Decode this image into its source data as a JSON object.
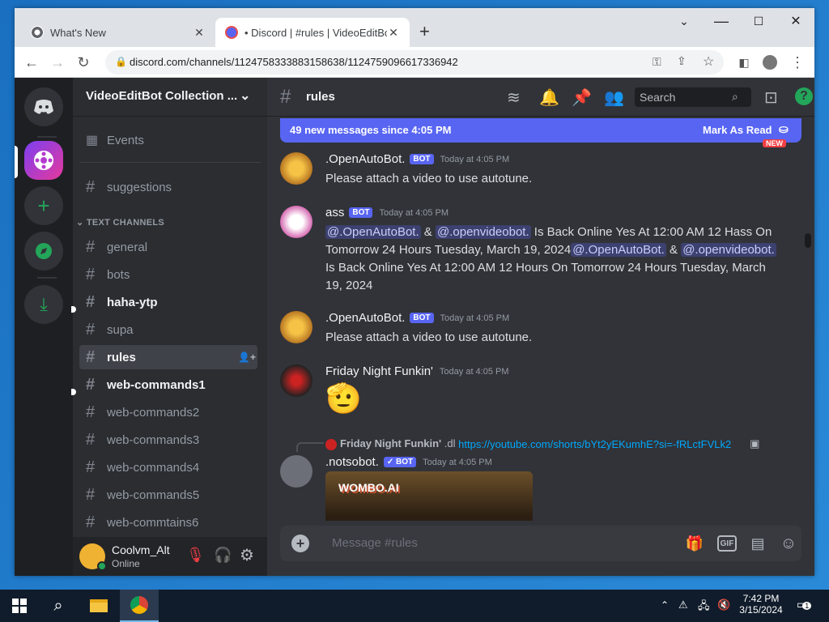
{
  "browser": {
    "tabs": [
      {
        "title": "What's New"
      },
      {
        "title": "• Discord | #rules | VideoEditBot"
      }
    ],
    "new_tab": "+",
    "url": "discord.com/channels/1124758333883158638/1124759096617336942"
  },
  "discord": {
    "server_name": "VideoEditBot Collection ...",
    "events_label": "Events",
    "suggestions_label": "suggestions",
    "category_label": "TEXT CHANNELS",
    "channels": [
      {
        "name": "general"
      },
      {
        "name": "bots"
      },
      {
        "name": "haha-ytp"
      },
      {
        "name": "supa"
      },
      {
        "name": "rules"
      },
      {
        "name": "web-commands1"
      },
      {
        "name": "web-commands2"
      },
      {
        "name": "web-commands3"
      },
      {
        "name": "web-commands4"
      },
      {
        "name": "web-commands5"
      },
      {
        "name": "web-commtains6"
      }
    ],
    "user": {
      "name": "Coolvm_Alt",
      "status": "Online"
    },
    "chat_header": {
      "channel": "rules",
      "search_placeholder": "Search"
    },
    "new_messages": {
      "text": "49 new messages since 4:05 PM",
      "action": "Mark As Read",
      "new_tag": "NEW"
    },
    "messages": [
      {
        "author": "OpenAutoBot.",
        "prefix": ".",
        "bot": "BOT",
        "time": "Today at 4:05 PM",
        "text": "Please attach a video to use autotune."
      },
      {
        "author": "ass",
        "bot": "BOT",
        "time": "Today at 4:05 PM",
        "mention1": "@.OpenAutoBot.",
        "amp1": " & ",
        "mention2": "@.openvideobot.",
        "text1": " Is Back Online Yes At 12:00 AM 12 Hass On Tomorrow 24 Hours Tuesday, March 19, 2024",
        "mention3": "@.OpenAutoBot.",
        "amp2": " & ",
        "mention4": "@.openvideobot.",
        "text2": " Is Back Online Yes At 12:00 AM 12 Hours On Tomorrow 24 Hours Tuesday, March 19, 2024"
      },
      {
        "author": ".OpenAutoBot.",
        "bot": "BOT",
        "time": "Today at 4:05 PM",
        "text": "Please attach a video to use autotune."
      },
      {
        "author": "Friday Night Funkin'",
        "time": "Today at 4:05 PM",
        "emoji": "🫡"
      },
      {
        "reply_author": "Friday Night Funkin'",
        "reply_text": ".dl",
        "reply_link": "https://youtube.com/shorts/bYt2yEKumhE?si=-fRLctFVLk2",
        "author": ".notsobot.",
        "bot": "✓ BOT",
        "time": "Today at 4:05 PM",
        "embed_text": "WOMBO.AI"
      }
    ],
    "composer_placeholder": "Message #rules"
  },
  "taskbar": {
    "time": "7:42 PM",
    "date": "3/15/2024",
    "notification_count": "1"
  },
  "colors": {
    "blurple": "#5865f2",
    "discord_bg": "#313338",
    "sidebar": "#2b2d31",
    "rail": "#1e1f22",
    "green": "#23a55a"
  }
}
